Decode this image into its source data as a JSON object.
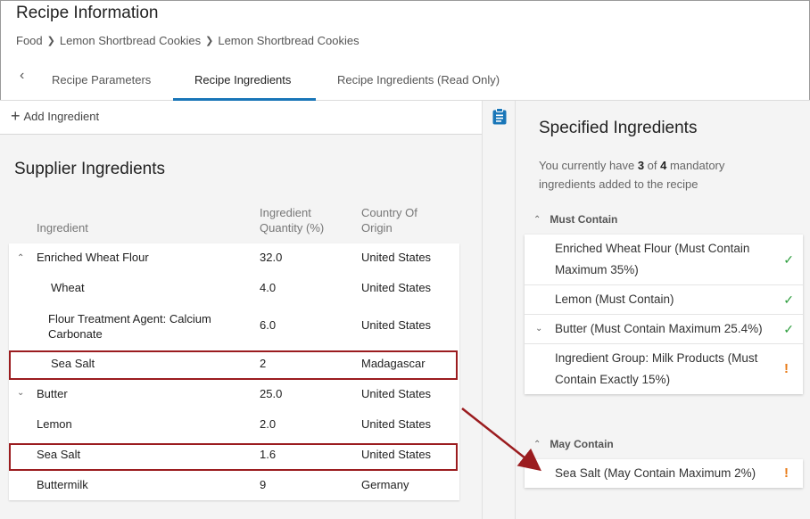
{
  "header": {
    "title": "Recipe Information",
    "breadcrumb": [
      "Food",
      "Lemon Shortbread Cookies",
      "Lemon Shortbread Cookies"
    ]
  },
  "tabs": [
    {
      "label": "Recipe Parameters"
    },
    {
      "label": "Recipe Ingredients"
    },
    {
      "label": "Recipe Ingredients (Read Only)"
    }
  ],
  "toolbar": {
    "add_label": "Add Ingredient"
  },
  "supplier": {
    "title": "Supplier Ingredients",
    "columns": {
      "ingredient": "Ingredient",
      "quantity": "Ingredient Quantity (%)",
      "country": "Country Of Origin"
    },
    "rows": [
      {
        "name": "Enriched Wheat Flour",
        "qty": "32.0",
        "country": "United States"
      },
      {
        "name": "Wheat",
        "qty": "4.0",
        "country": "United States"
      },
      {
        "name": "Flour Treatment Agent: Calcium Carbonate",
        "qty": "6.0",
        "country": "United States"
      },
      {
        "name": "Sea Salt",
        "qty": "2",
        "country": "Madagascar"
      },
      {
        "name": "Butter",
        "qty": "25.0",
        "country": "United States"
      },
      {
        "name": "Lemon",
        "qty": "2.0",
        "country": "United States"
      },
      {
        "name": "Sea Salt",
        "qty": "1.6",
        "country": "United States"
      },
      {
        "name": "Buttermilk",
        "qty": "9",
        "country": "Germany"
      }
    ]
  },
  "specified": {
    "title": "Specified Ingredients",
    "desc_pre": "You currently have ",
    "have": "3",
    "desc_mid": " of ",
    "total": "4",
    "desc_post": " mandatory ingredients added to the recipe",
    "must_label": "Must Contain",
    "must_items": [
      {
        "label": "Enriched Wheat Flour (Must Contain Maximum 35%)",
        "status": "check"
      },
      {
        "label": "Lemon (Must Contain)",
        "status": "check"
      },
      {
        "label": "Butter (Must Contain Maximum 25.4%)",
        "status": "check"
      },
      {
        "label": "Ingredient Group: Milk Products (Must Contain Exactly 15%)",
        "status": "warning"
      }
    ],
    "may_label": "May Contain",
    "may_items": [
      {
        "label": "Sea Salt (May Contain Maximum 2%)",
        "status": "warning"
      }
    ]
  },
  "colors": {
    "accent": "#1976b8",
    "highlight": "#9b1c1f",
    "check": "#2e9e3e",
    "warning": "#e87a16"
  }
}
